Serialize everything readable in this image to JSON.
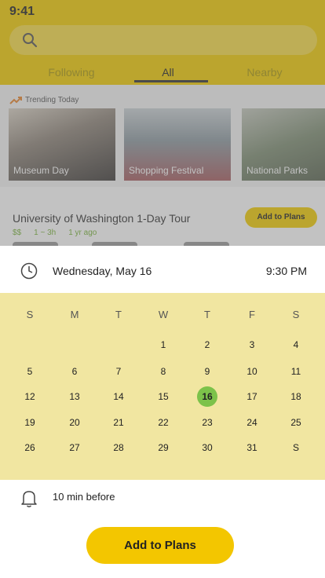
{
  "status": {
    "time": "9:41"
  },
  "search": {
    "icon": "search-icon"
  },
  "tabs": [
    {
      "label": "Following"
    },
    {
      "label": "All"
    },
    {
      "label": "Nearby"
    }
  ],
  "trending": {
    "label": "Trending Today",
    "cards": [
      {
        "caption": "Museum Day"
      },
      {
        "caption": "Shopping Festival"
      },
      {
        "caption": "National Parks"
      }
    ]
  },
  "tour": {
    "title": "University of Washington 1-Day Tour",
    "price": "$$",
    "duration": "1 ~ 3h",
    "age": "1 yr ago",
    "button": "Add to Plans"
  },
  "sheet": {
    "date": "Wednesday, May 16",
    "time": "9:30 PM",
    "weekdays": [
      "S",
      "M",
      "T",
      "W",
      "T",
      "F",
      "S"
    ],
    "weeks": [
      [
        "",
        "",
        "",
        "1",
        "2",
        "3",
        "4"
      ],
      [
        "5",
        "6",
        "7",
        "8",
        "9",
        "10",
        "11"
      ],
      [
        "12",
        "13",
        "14",
        "15",
        "16",
        "17",
        "18"
      ],
      [
        "19",
        "20",
        "21",
        "22",
        "23",
        "24",
        "25"
      ],
      [
        "26",
        "27",
        "28",
        "29",
        "30",
        "31",
        "S"
      ]
    ],
    "selected_day": "16",
    "reminder": "10 min before",
    "add_button": "Add to Plans"
  },
  "colors": {
    "accent": "#f3cd00",
    "calendar_bg": "#f1e6a1",
    "selected": "#7cc24a"
  }
}
